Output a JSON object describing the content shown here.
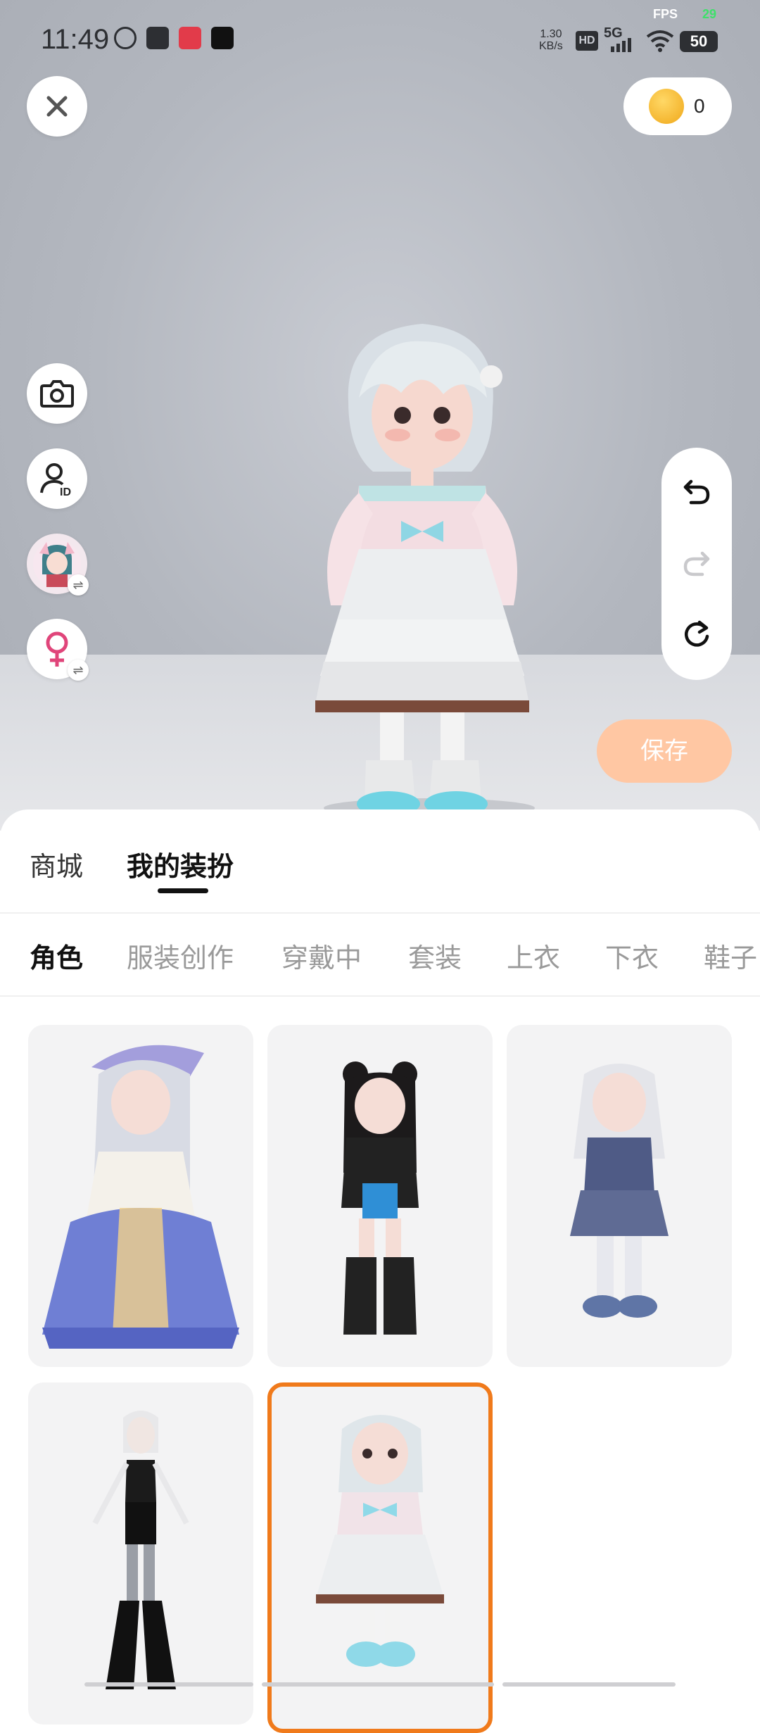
{
  "status_bar": {
    "time": "11:49",
    "fps_label": "FPS",
    "fps_value": "29",
    "net_speed": "1.30",
    "net_unit": "KB/s",
    "hd": "HD",
    "network": "5G",
    "battery": "50"
  },
  "top": {
    "coins": "0"
  },
  "actions": {
    "save_label": "保存"
  },
  "sheet": {
    "tabs": [
      {
        "label": "商城"
      },
      {
        "label": "我的装扮"
      }
    ],
    "categories": [
      {
        "label": "角色"
      },
      {
        "label": "服装创作"
      },
      {
        "label": "穿戴中"
      },
      {
        "label": "套装"
      },
      {
        "label": "上衣"
      },
      {
        "label": "下衣"
      },
      {
        "label": "鞋子"
      }
    ],
    "characters": [
      {
        "name": "character-1",
        "hair": "#d8dbe4",
        "outfit": "#6f7fd4",
        "accent": "#f3d28a"
      },
      {
        "name": "character-2",
        "hair": "#1c1a1b",
        "outfit": "#222222",
        "accent": "#2f8fd6"
      },
      {
        "name": "character-3",
        "hair": "#e4e5ea",
        "outfit": "#4f5b86",
        "accent": "#d9dbe4"
      },
      {
        "name": "character-4",
        "hair": "#e8e8ea",
        "outfit": "#1b1b1b",
        "accent": "#9a9ea6"
      },
      {
        "name": "character-5",
        "hair": "#dfe6ea",
        "outfit": "#f1e3e8",
        "accent": "#8fd9e8",
        "selected": true
      }
    ]
  },
  "colors": {
    "accent": "#f07a1b",
    "save_button": "#ffc7a3"
  }
}
